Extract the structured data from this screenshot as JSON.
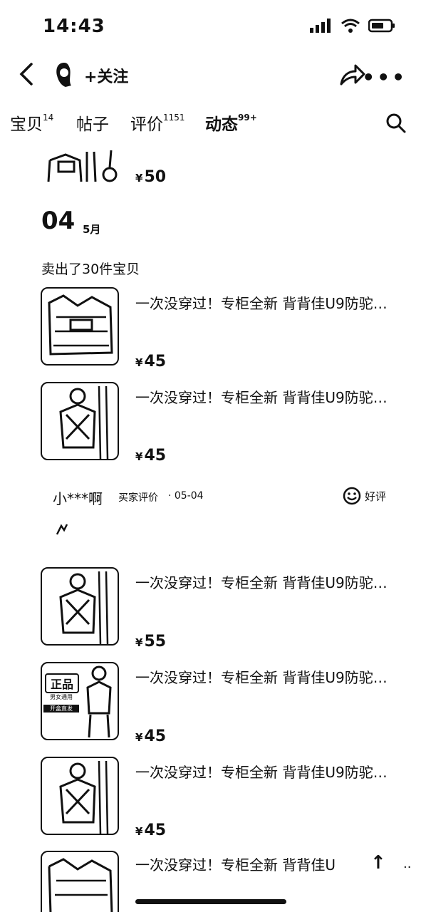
{
  "status_bar": {
    "time": "14:43"
  },
  "header": {
    "follow_label": "+关注"
  },
  "tabs": [
    {
      "label": "宝贝",
      "count": "14"
    },
    {
      "label": "帖子",
      "count": ""
    },
    {
      "label": "评价",
      "count": "1151"
    },
    {
      "label": "动态",
      "count": "99+"
    }
  ],
  "top_item": {
    "price": "50"
  },
  "date": {
    "day": "04",
    "month": "5月"
  },
  "sold_text": "卖出了30件宝贝",
  "items": [
    {
      "title": "一次没穿过！专柜全新 背背佳U9防驼…",
      "price": "45"
    },
    {
      "title": "一次没穿过！专柜全新 背背佳U9防驼…",
      "price": "45"
    },
    {
      "title": "一次没穿过！专柜全新 背背佳U9防驼…",
      "price": "55"
    },
    {
      "title": "一次没穿过！专柜全新 背背佳U9防驼…",
      "price": "45"
    },
    {
      "title": "一次没穿过！专柜全新 背背佳U9防驼…",
      "price": "45"
    },
    {
      "title": "一次没穿过！专柜全新 背背佳U"
    }
  ],
  "review": {
    "user": "小***啊",
    "tag": "买家评价",
    "date": "· 05-04",
    "rating": "好评"
  },
  "badge": {
    "line1": "正品",
    "line2": "男女通用",
    "line3": "开盒直发"
  },
  "currency": "¥",
  "icons": [
    "back-icon",
    "follow-avatar",
    "share-icon",
    "more-icon",
    "search-icon",
    "smile-icon",
    "scroll-top-icon"
  ]
}
